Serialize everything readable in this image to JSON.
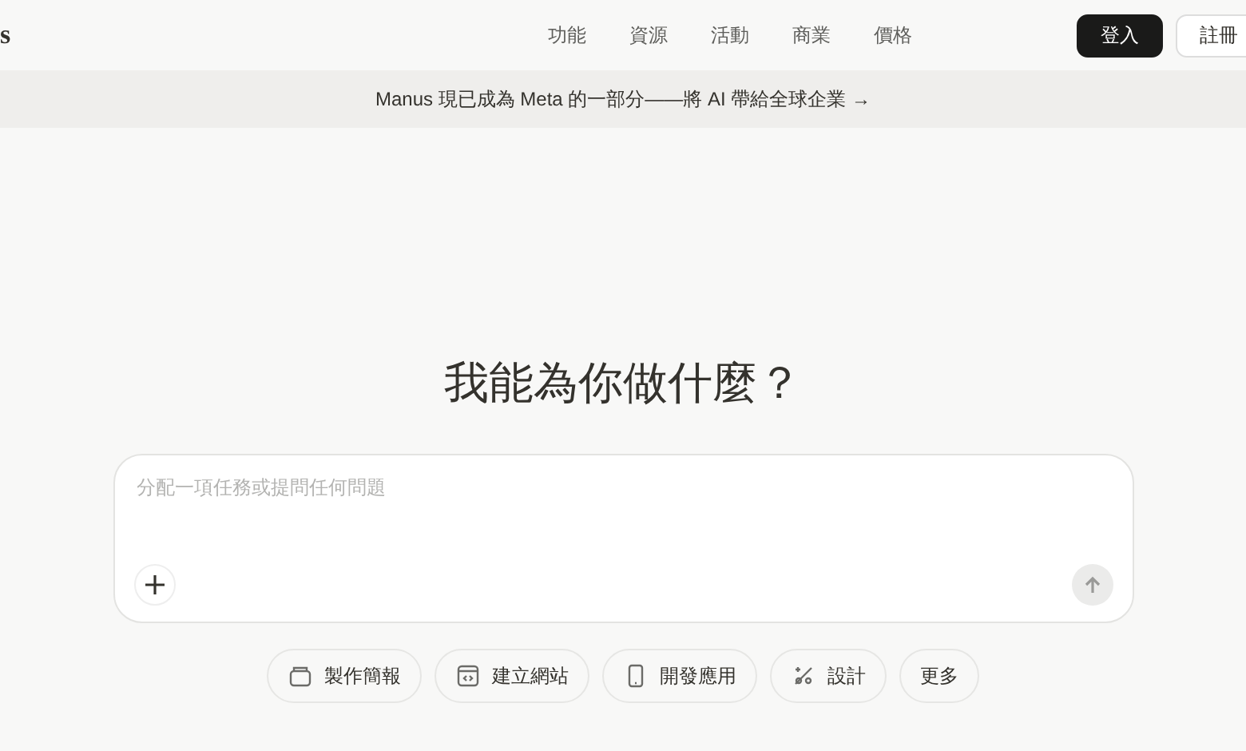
{
  "logo": {
    "text": "s"
  },
  "nav": [
    {
      "label": "功能"
    },
    {
      "label": "資源"
    },
    {
      "label": "活動"
    },
    {
      "label": "商業"
    },
    {
      "label": "價格"
    }
  ],
  "auth_buttons": [
    {
      "label": "登入",
      "kind": "primary"
    },
    {
      "label": "註冊",
      "kind": "outline"
    }
  ],
  "banner": {
    "text": "Manus 現已成為 Meta 的一部分——將 AI 帶給全球企業",
    "arrow": "→"
  },
  "heading": "我能為你做什麼？",
  "prompt": {
    "placeholder": "分配一項任務或提問任何問題"
  },
  "chips": [
    {
      "label": "製作簡報",
      "kind": "slides"
    },
    {
      "label": "建立網站",
      "kind": "web"
    },
    {
      "label": "開發應用",
      "kind": "app"
    },
    {
      "label": "設計",
      "kind": "design"
    },
    {
      "label": "更多",
      "kind": "more"
    }
  ]
}
